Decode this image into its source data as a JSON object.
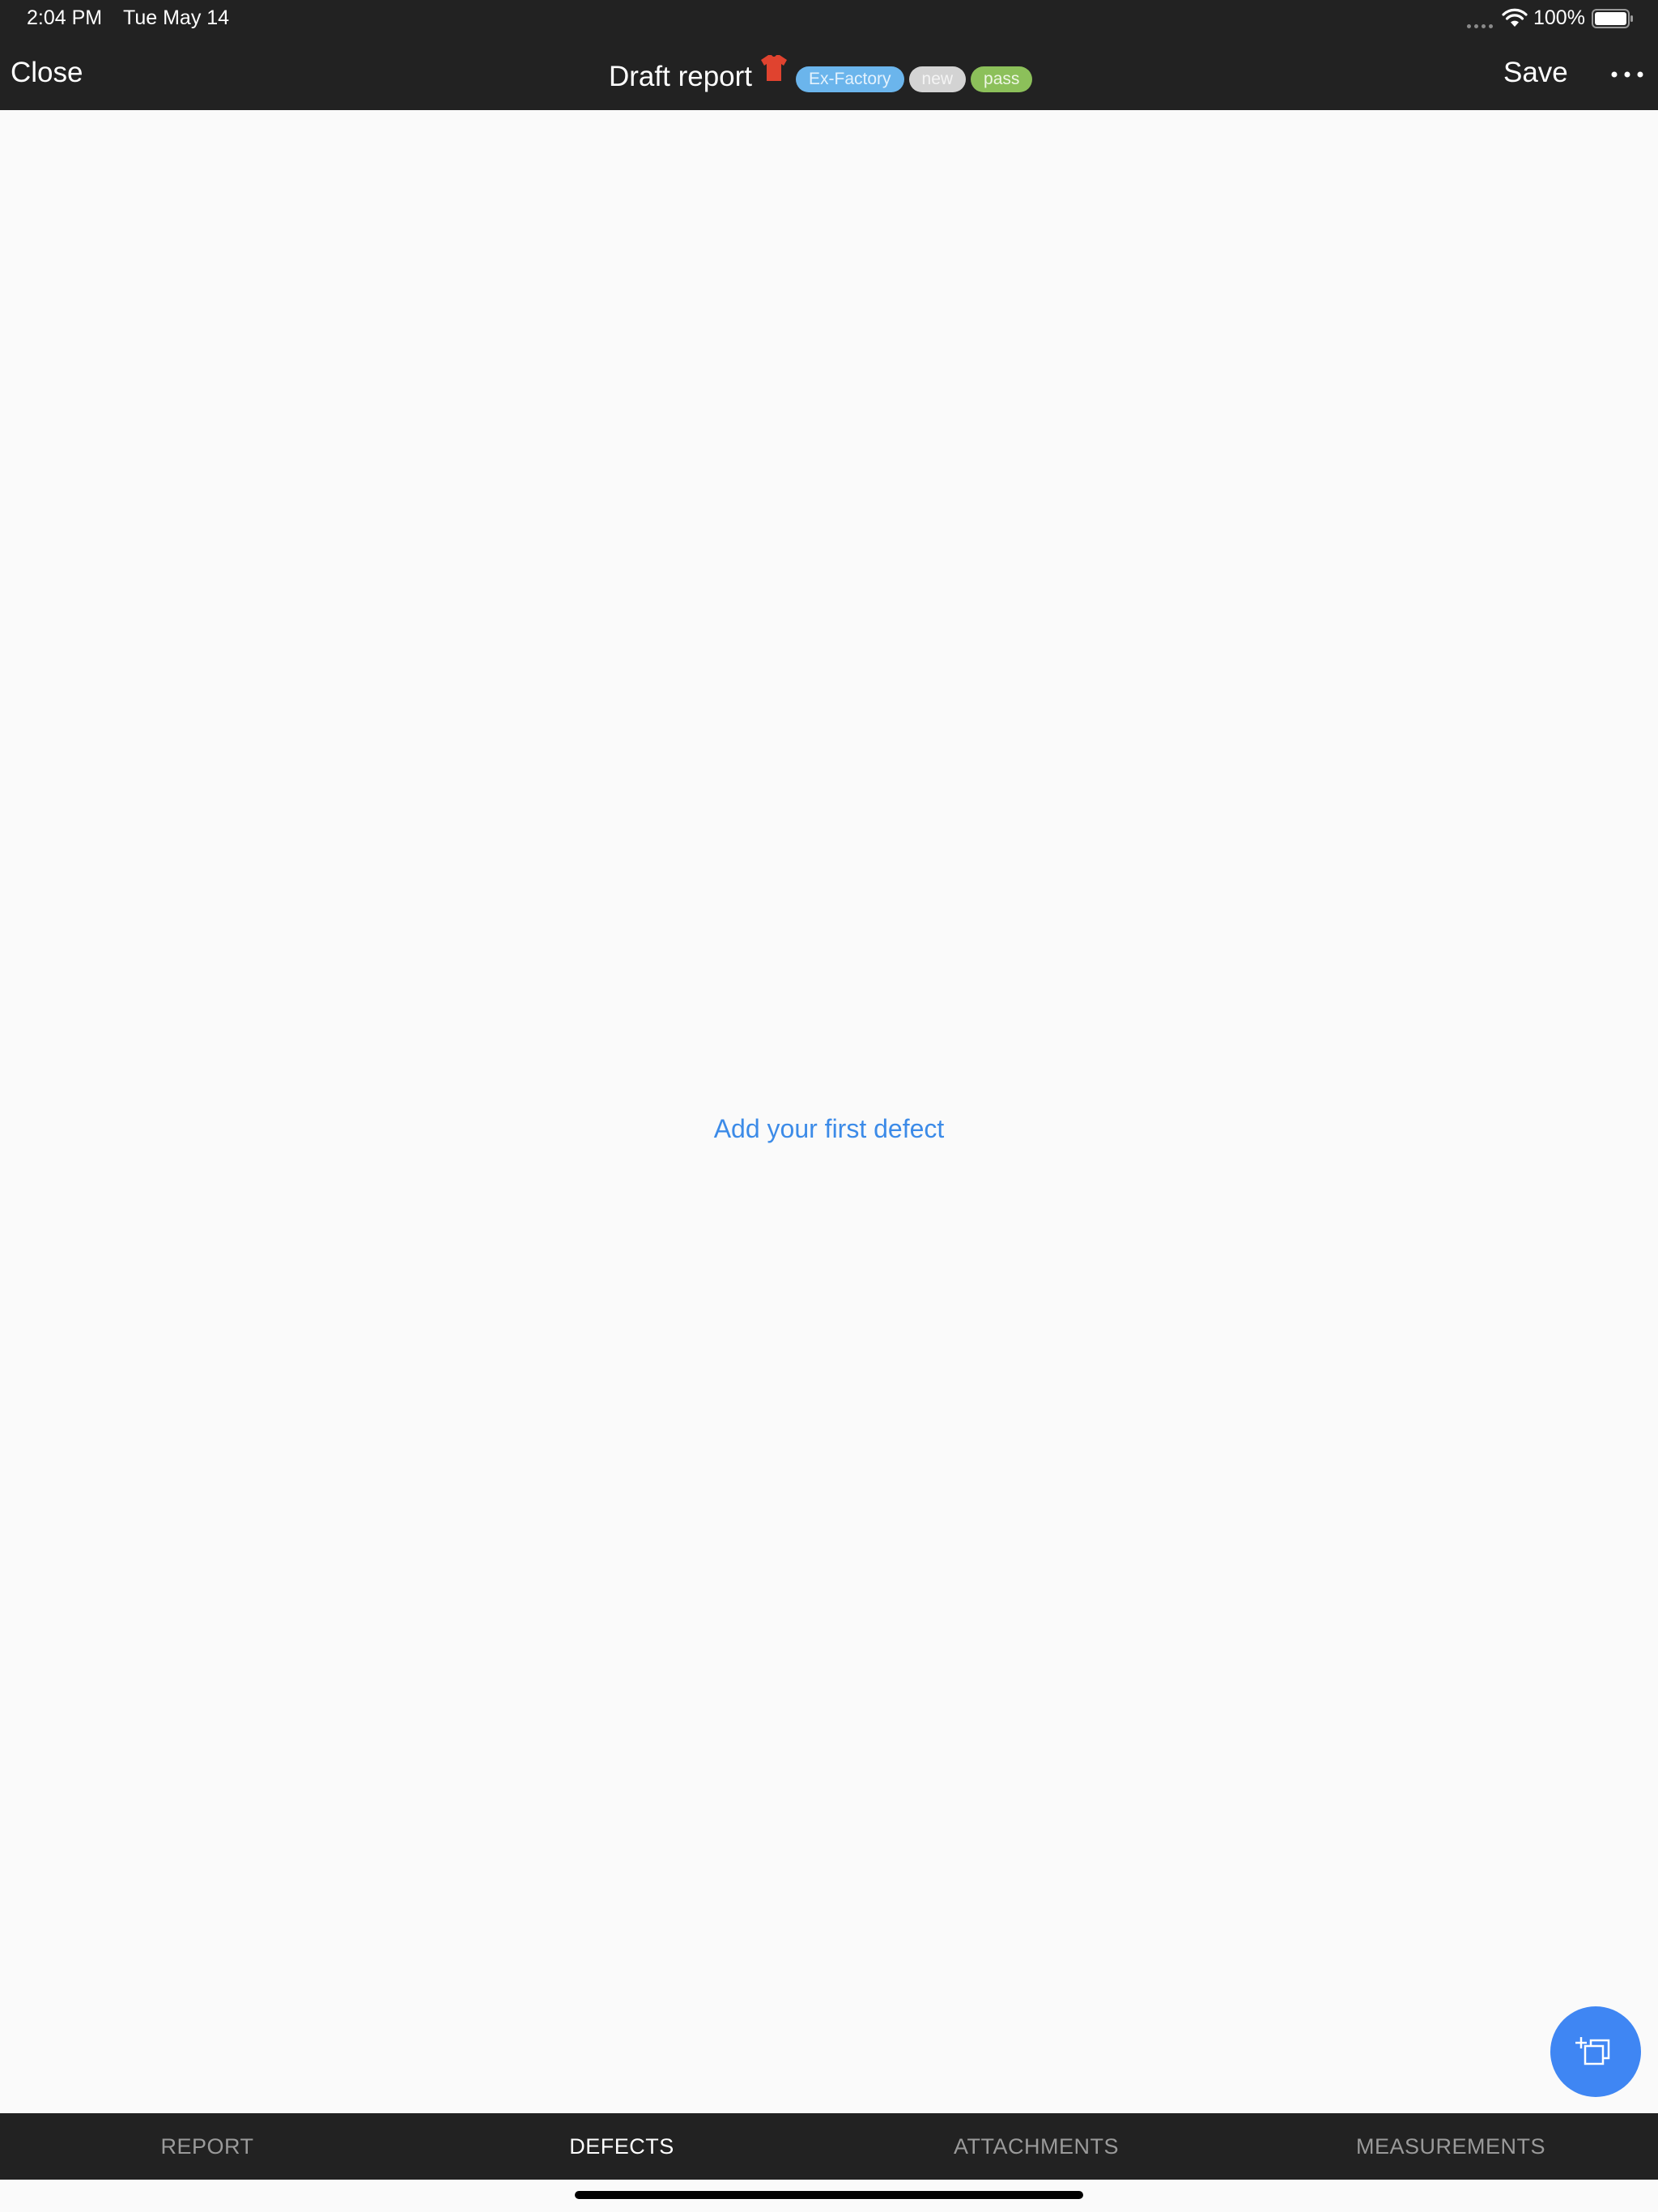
{
  "status_bar": {
    "time": "2:04 PM",
    "date": "Tue May 14",
    "battery": "100%"
  },
  "nav": {
    "close_label": "Close",
    "title": "Draft report",
    "badges": {
      "type": "Ex-Factory",
      "state": "new",
      "result": "pass"
    },
    "save_label": "Save",
    "more_icon": "ellipsis-icon",
    "title_icon": "tshirt-icon"
  },
  "content": {
    "empty_action": "Add your first defect",
    "fab_icon": "add-defect-icon"
  },
  "tabs": [
    {
      "label": "REPORT",
      "active": false
    },
    {
      "label": "DEFECTS",
      "active": true
    },
    {
      "label": "ATTACHMENTS",
      "active": false
    },
    {
      "label": "MEASUREMENTS",
      "active": false
    }
  ],
  "colors": {
    "bar_background": "#222222",
    "accent": "#3f86f3",
    "link": "#3c8be8",
    "badge_type": "#6bb5ec",
    "badge_state": "#d3d3d3",
    "badge_result": "#8cc05a",
    "shirt": "#e0432f"
  }
}
